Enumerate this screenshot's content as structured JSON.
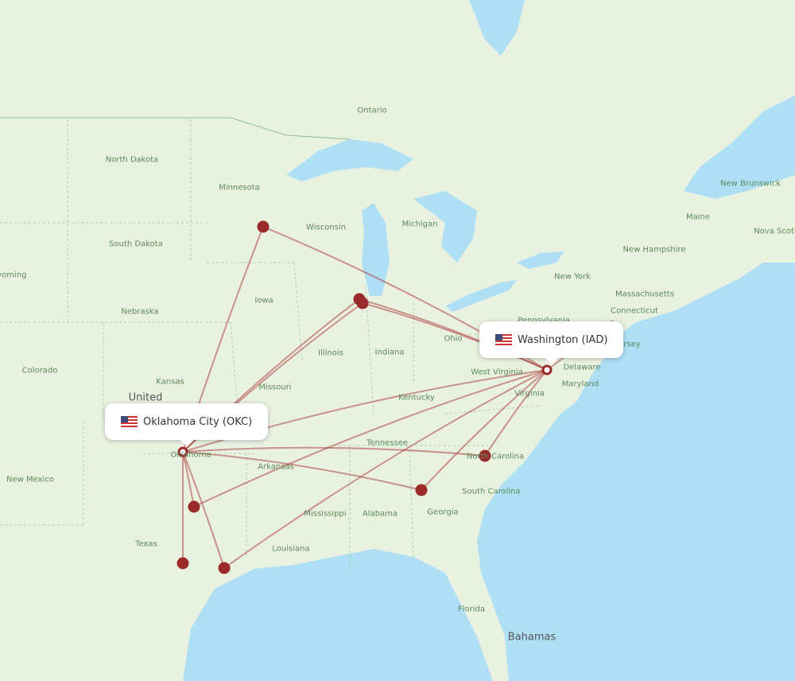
{
  "origin": {
    "label": "Oklahoma City (OKC)",
    "icon": "us-flag-icon"
  },
  "destination": {
    "label": "Washington (IAD)",
    "icon": "us-flag-icon"
  },
  "colors": {
    "route": "#a33",
    "marker": "#9b2a2a",
    "water": "#aedff5",
    "land": "#e9f1e0"
  },
  "labels": [
    "Ontario",
    "North Dakota",
    "Minnesota",
    "Wisconsin",
    "Michigan",
    "South Dakota",
    "Iowa",
    "Nebraska",
    "Illinois",
    "Indiana",
    "Ohio",
    "Colorado",
    "Kansas",
    "United",
    "Missouri",
    "Kentucky",
    "West Virginia",
    "Virginia",
    "Tennessee",
    "North Carolina",
    "Arkansas",
    "New Mexico",
    "Oklahoma",
    "South Carolina",
    "Mississippi",
    "Alabama",
    "Georgia",
    "Texas",
    "Louisiana",
    "Florida",
    "Bahamas",
    "New York",
    "Pennsylvania",
    "Delaware",
    "Maryland",
    "New Jersey",
    "Connecticut",
    "Massachusetts",
    "New Hampshire",
    "Maine",
    "New Brunswick",
    "Nova Scotia",
    "Wyoming"
  ]
}
